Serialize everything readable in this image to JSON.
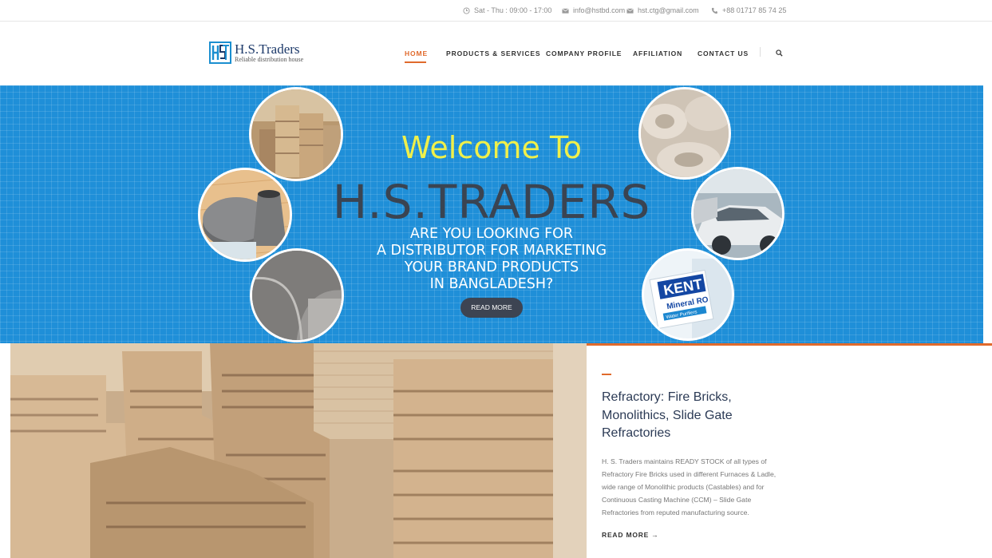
{
  "topbar": {
    "hours": "Sat - Thu : 09:00 - 17:00",
    "email1": "info@hstbd.com",
    "email2": "hst.ctg@gmail.com",
    "phone": "+88 01717 85 74 25",
    "icons": [
      "clock-icon",
      "envelope-icon",
      "envelope-icon",
      "phone-icon"
    ]
  },
  "header": {
    "logo_name": "H.S.Traders",
    "logo_tagline": "Reliable distribution house",
    "nav": [
      {
        "label": "HOME",
        "active": true
      },
      {
        "label": "PRODUCTS & SERVICES",
        "active": false
      },
      {
        "label": "COMPANY PROFILE",
        "active": false
      },
      {
        "label": "AFFILIATION",
        "active": false
      },
      {
        "label": "CONTACT US",
        "active": false
      }
    ]
  },
  "hero": {
    "welcome": "Welcome To",
    "brand": "H.S.TRADERS",
    "tagline_lines": [
      "ARE YOU LOOKING FOR",
      "A DISTRIBUTOR FOR MARKETING",
      "YOUR BRAND PRODUCTS",
      "IN BANGLADESH?"
    ],
    "button": "READ MORE",
    "kent_label": "KENT",
    "kent_sub": "Mineral RO",
    "kent_sub2": "Water Purifiers"
  },
  "section": {
    "title": "Refractory: Fire Bricks, Monolithics, Slide Gate Refractories",
    "body": "H. S. Traders maintains READY STOCK of all types of Refractory Fire Bricks used in different Furnaces & Ladle, wide range of Monolithic products (Castables) and for Continuous Casting Machine (CCM) – Slide Gate Refractories from reputed manufacturing source.",
    "read_more": "READ MORE →"
  },
  "colors": {
    "accent": "#e06a2c",
    "hero_blue": "#1f8fd8",
    "welcome_yellow": "#f0f04a",
    "brand_dark": "#3a4452"
  }
}
